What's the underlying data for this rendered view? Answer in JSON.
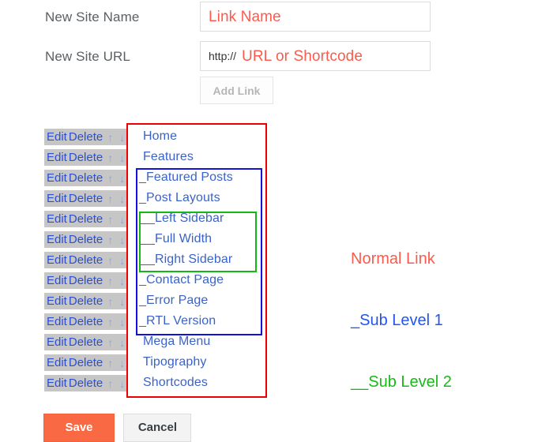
{
  "form": {
    "name_field": {
      "label": "New Site Name",
      "value": "",
      "placeholder": "Link Name"
    },
    "url_field": {
      "label": "New Site URL",
      "prefix": "http://",
      "value": "",
      "placeholder": "URL or Shortcode"
    },
    "add_link_label": "Add Link"
  },
  "row_actions": {
    "edit_label": "Edit",
    "delete_label": "Delete",
    "move_up_icon": "↑",
    "move_down_icon": "↓"
  },
  "links": [
    {
      "title": "Home",
      "level": 0
    },
    {
      "title": "Features",
      "level": 0
    },
    {
      "title": "_Featured Posts",
      "level": 1
    },
    {
      "title": "_Post Layouts",
      "level": 1
    },
    {
      "title": "__Left Sidebar",
      "level": 2
    },
    {
      "title": "__Full Width",
      "level": 2
    },
    {
      "title": "__Right Sidebar",
      "level": 2
    },
    {
      "title": "_Contact Page",
      "level": 1
    },
    {
      "title": "_Error Page",
      "level": 1
    },
    {
      "title": "_RTL Version",
      "level": 1
    },
    {
      "title": "Mega Menu",
      "level": 0
    },
    {
      "title": "Tipography",
      "level": 0
    },
    {
      "title": "Shortcodes",
      "level": 0
    }
  ],
  "legend": {
    "normal": "Normal Link",
    "sub1": "_Sub Level 1",
    "sub2": "__Sub Level 2"
  },
  "footer": {
    "save_label": "Save",
    "cancel_label": "Cancel"
  },
  "colors": {
    "normal_link": "#fb5b4d",
    "sub_level_1": "#2255ee",
    "sub_level_2": "#16bb16",
    "save_button": "#f96a44",
    "link_text": "#3a63c9",
    "row_background": "#c6c6c6"
  }
}
